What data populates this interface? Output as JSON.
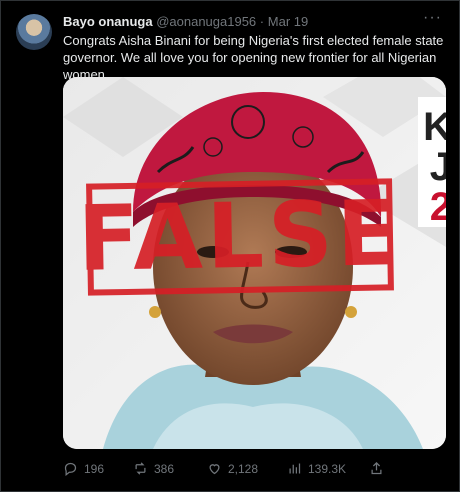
{
  "tweet": {
    "author_name": "Bayo onanuga",
    "author_handle": "@aonanuga1956",
    "separator": "·",
    "date": "Mar 19",
    "text": "Congrats Aisha Binani for being Nigeria's first elected female state governor. We all love you for opening new frontier  for all Nigerian women."
  },
  "media": {
    "stamp_text": "FALSE",
    "side_text_1": "K",
    "side_text_2": "J",
    "side_text_3": "2",
    "accent_red": "#d61f26",
    "side_text_2_color": "#222222",
    "side_text_3_color": "#c8102e"
  },
  "actions": {
    "replies": "196",
    "retweets": "386",
    "likes": "2,128",
    "views": "139.3K"
  }
}
